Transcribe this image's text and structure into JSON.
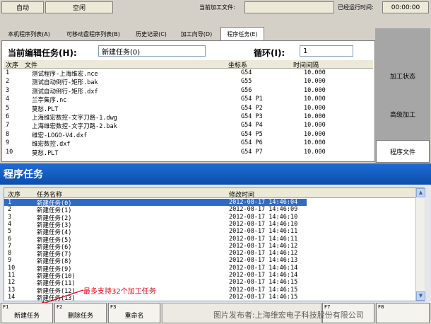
{
  "status": {
    "mode": "自动",
    "state": "空闲",
    "current_file_label": "当前加工文件:",
    "current_file_value": "",
    "elapsed_label": "已经运行时间:",
    "elapsed_value": "00:00:00"
  },
  "tabs": [
    {
      "label": "本机程序列表(A)"
    },
    {
      "label": "可移动盘程序列表(B)"
    },
    {
      "label": "历史记录(C)"
    },
    {
      "label": "加工向导(D)"
    },
    {
      "label": "程序任务(E)"
    }
  ],
  "editor": {
    "task_label": "当前编辑任务(H):",
    "task_value": "新建任务(0)",
    "loop_label": "循环(I):",
    "loop_value": "1"
  },
  "program_table": {
    "headers": [
      "次序",
      "文件",
      "坐标系",
      "时间间隔"
    ],
    "rows": [
      [
        "1",
        "测试程序-上海维宏.nce",
        "G54",
        "10.000"
      ],
      [
        "2",
        "测试自动倒行-矩形.bak",
        "G55",
        "10.000"
      ],
      [
        "3",
        "测试自动倒行-矩形.dxf",
        "G56",
        "10.000"
      ],
      [
        "4",
        "兰亭集序.nc",
        "G54 P1",
        "10.000"
      ],
      [
        "5",
        "莫愁.PLT",
        "G54 P2",
        "10.000"
      ],
      [
        "6",
        "上海维宏数控-文字刀路-1.dwg",
        "G54 P3",
        "10.000"
      ],
      [
        "7",
        "上海维宏数控-文字刀路-2.bak",
        "G54 P4",
        "10.000"
      ],
      [
        "8",
        "维宏-LOGO-V4.dxf",
        "G54 P5",
        "10.000"
      ],
      [
        "9",
        "维宏数控.dxf",
        "G54 P6",
        "10.000"
      ],
      [
        "10",
        "莫愁.PLT",
        "G54 P7",
        "10.000"
      ]
    ]
  },
  "side_buttons": [
    "加工状态",
    "高级加工",
    "程序文件"
  ],
  "task_panel": {
    "title": "程序任务",
    "headers": [
      "次序",
      "任务名称",
      "修改时间"
    ],
    "rows": [
      [
        "1",
        "新建任务(0)",
        "2012-08-17 14:46:04"
      ],
      [
        "2",
        "新建任务(1)",
        "2012-08-17 14:46:09"
      ],
      [
        "3",
        "新建任务(2)",
        "2012-08-17 14:46:10"
      ],
      [
        "4",
        "新建任务(3)",
        "2012-08-17 14:46:10"
      ],
      [
        "5",
        "新建任务(4)",
        "2012-08-17 14:46:11"
      ],
      [
        "6",
        "新建任务(5)",
        "2012-08-17 14:46:11"
      ],
      [
        "7",
        "新建任务(6)",
        "2012-08-17 14:46:12"
      ],
      [
        "8",
        "新建任务(7)",
        "2012-08-17 14:46:12"
      ],
      [
        "9",
        "新建任务(8)",
        "2012-08-17 14:46:13"
      ],
      [
        "10",
        "新建任务(9)",
        "2012-08-17 14:46:14"
      ],
      [
        "11",
        "新建任务(10)",
        "2012-08-17 14:46:14"
      ],
      [
        "12",
        "新建任务(11)",
        "2012-08-17 14:46:15"
      ],
      [
        "13",
        "新建任务(12)",
        "2012-08-17 14:46:15"
      ],
      [
        "14",
        "新建任务(13)",
        "2012-08-17 14:46:15"
      ]
    ],
    "annotation": "最多支持32个加工任务"
  },
  "fkeys": [
    {
      "key": "F1",
      "label": "新建任务"
    },
    {
      "key": "F2",
      "label": "删除任务"
    },
    {
      "key": "F3",
      "label": "重命名"
    },
    {
      "key": "F7",
      "label": ""
    },
    {
      "key": "F8",
      "label": ""
    }
  ],
  "watermark": "图片发布者:上海维宏电子科技股份有限公司",
  "colors": {
    "title_blue": "#0b4fa8",
    "selection_blue": "#316ac5",
    "annotation_red": "#e8000f"
  }
}
